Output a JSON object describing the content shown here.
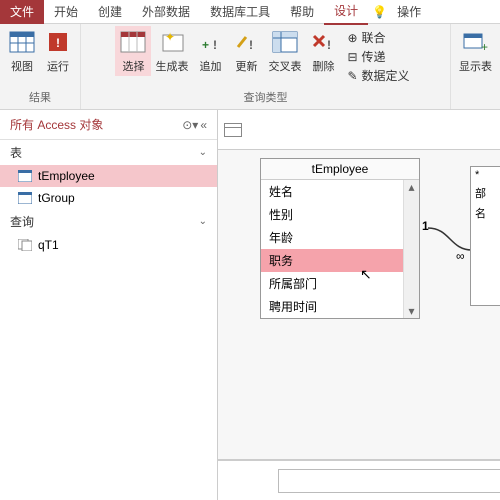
{
  "tabs": {
    "file": "文件",
    "start": "开始",
    "create": "创建",
    "extdata": "外部数据",
    "dbtools": "数据库工具",
    "help": "帮助",
    "design": "设计",
    "tellme": "操作"
  },
  "ribbon": {
    "view": "视图",
    "run": "运行",
    "select": "选择",
    "maketable": "生成表",
    "append": "追加",
    "update": "更新",
    "crosstab": "交叉表",
    "delete": "删除",
    "union": "联合",
    "passthrough": "传递",
    "datadef": "数据定义",
    "showtable": "显示表",
    "g_results": "结果",
    "g_querytype": "查询类型"
  },
  "nav": {
    "title": "所有 Access 对象",
    "cat_tables": "表",
    "cat_queries": "查询",
    "obj_temployee": "tEmployee",
    "obj_tgroup": "tGroup",
    "obj_qt1": "qT1"
  },
  "designer": {
    "table_title": "tEmployee",
    "fields": [
      "姓名",
      "性别",
      "年龄",
      "职务",
      "所属部门",
      "聘用时间"
    ],
    "selected_index": 3,
    "right_fields": [
      "*",
      "部",
      "名"
    ]
  }
}
